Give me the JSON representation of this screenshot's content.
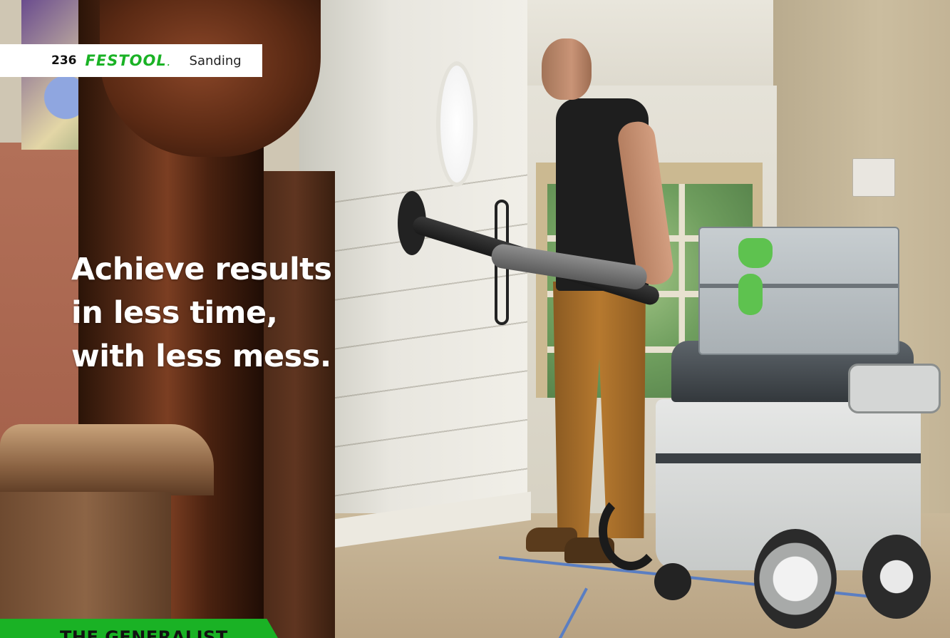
{
  "header": {
    "page_number": "236",
    "brand": "FESTOOL",
    "brand_dot": ".",
    "section": "Sanding"
  },
  "headline": {
    "lines": [
      "Achieve results",
      "in less time,",
      "with less mess."
    ]
  },
  "green_tag": {
    "label": "THE GENERALIST"
  },
  "colors": {
    "brand_green": "#1ab225",
    "headline_text": "#ffffff",
    "header_background": "#ffffff"
  }
}
